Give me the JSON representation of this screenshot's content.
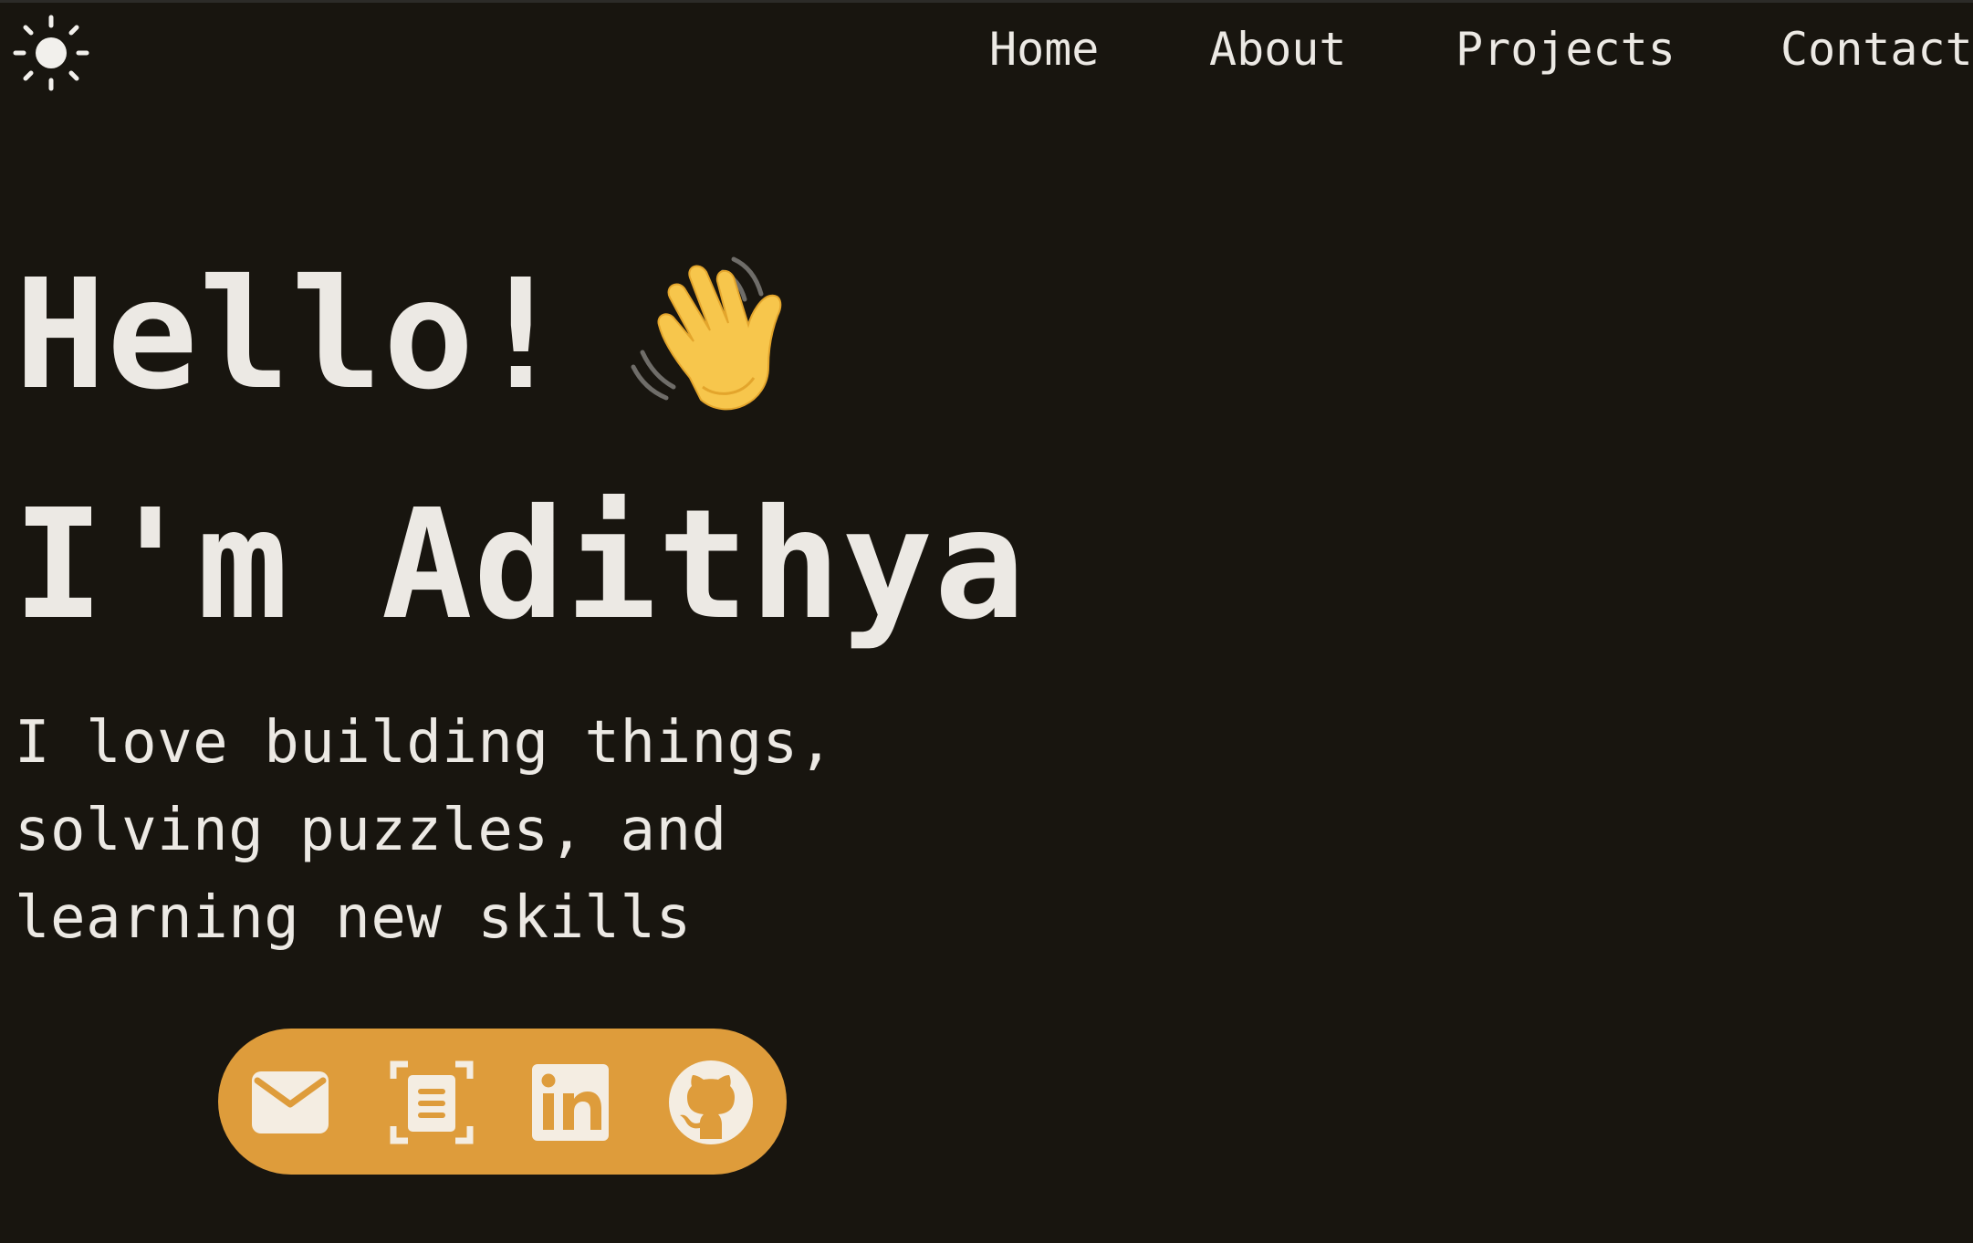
{
  "theme_toggle": {
    "icon": "sun-icon"
  },
  "nav": {
    "items": [
      {
        "label": "Home"
      },
      {
        "label": "About"
      },
      {
        "label": "Projects"
      },
      {
        "label": "Contact"
      }
    ]
  },
  "hero": {
    "greeting": "Hello!",
    "greeting_emoji": "waving-hand-icon",
    "name": "I'm Adithya",
    "tagline": [
      "I love building things,",
      "solving puzzles, and",
      "learning new skills"
    ]
  },
  "socials": {
    "background": "#de9c3b",
    "icons": [
      "email-icon",
      "resume-icon",
      "linkedin-icon",
      "github-icon"
    ]
  },
  "colors": {
    "background": "#18150f",
    "text": "#ece9e4",
    "accent": "#de9c3b"
  }
}
